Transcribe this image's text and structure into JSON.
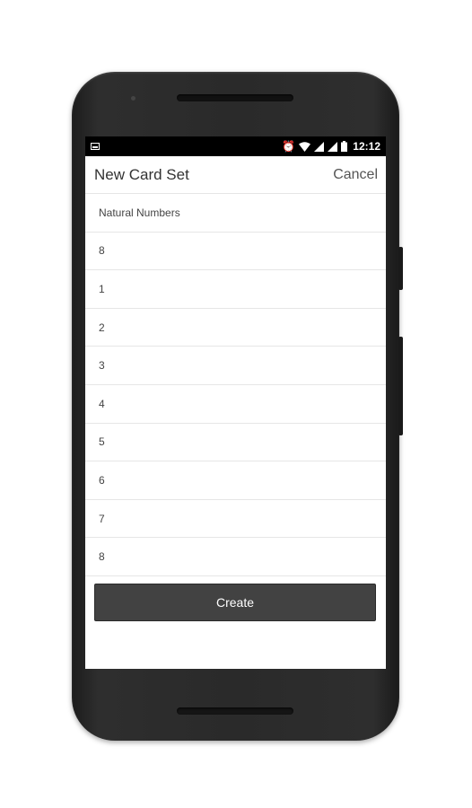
{
  "status_bar": {
    "time": "12:12",
    "icons": [
      "notification-icon",
      "alarm-icon",
      "wifi-icon",
      "signal-icon",
      "signal-icon",
      "battery-icon"
    ]
  },
  "header": {
    "title": "New Card Set",
    "cancel_label": "Cancel"
  },
  "form": {
    "fields": [
      {
        "value": "Natural Numbers"
      },
      {
        "value": "8"
      },
      {
        "value": "1"
      },
      {
        "value": "2"
      },
      {
        "value": "3"
      },
      {
        "value": "4"
      },
      {
        "value": "5"
      },
      {
        "value": "6"
      },
      {
        "value": "7"
      },
      {
        "value": "8"
      }
    ],
    "create_label": "Create"
  },
  "colors": {
    "status_bar": "#000000",
    "button": "#424242",
    "phone_body": "#2a2a2a"
  }
}
